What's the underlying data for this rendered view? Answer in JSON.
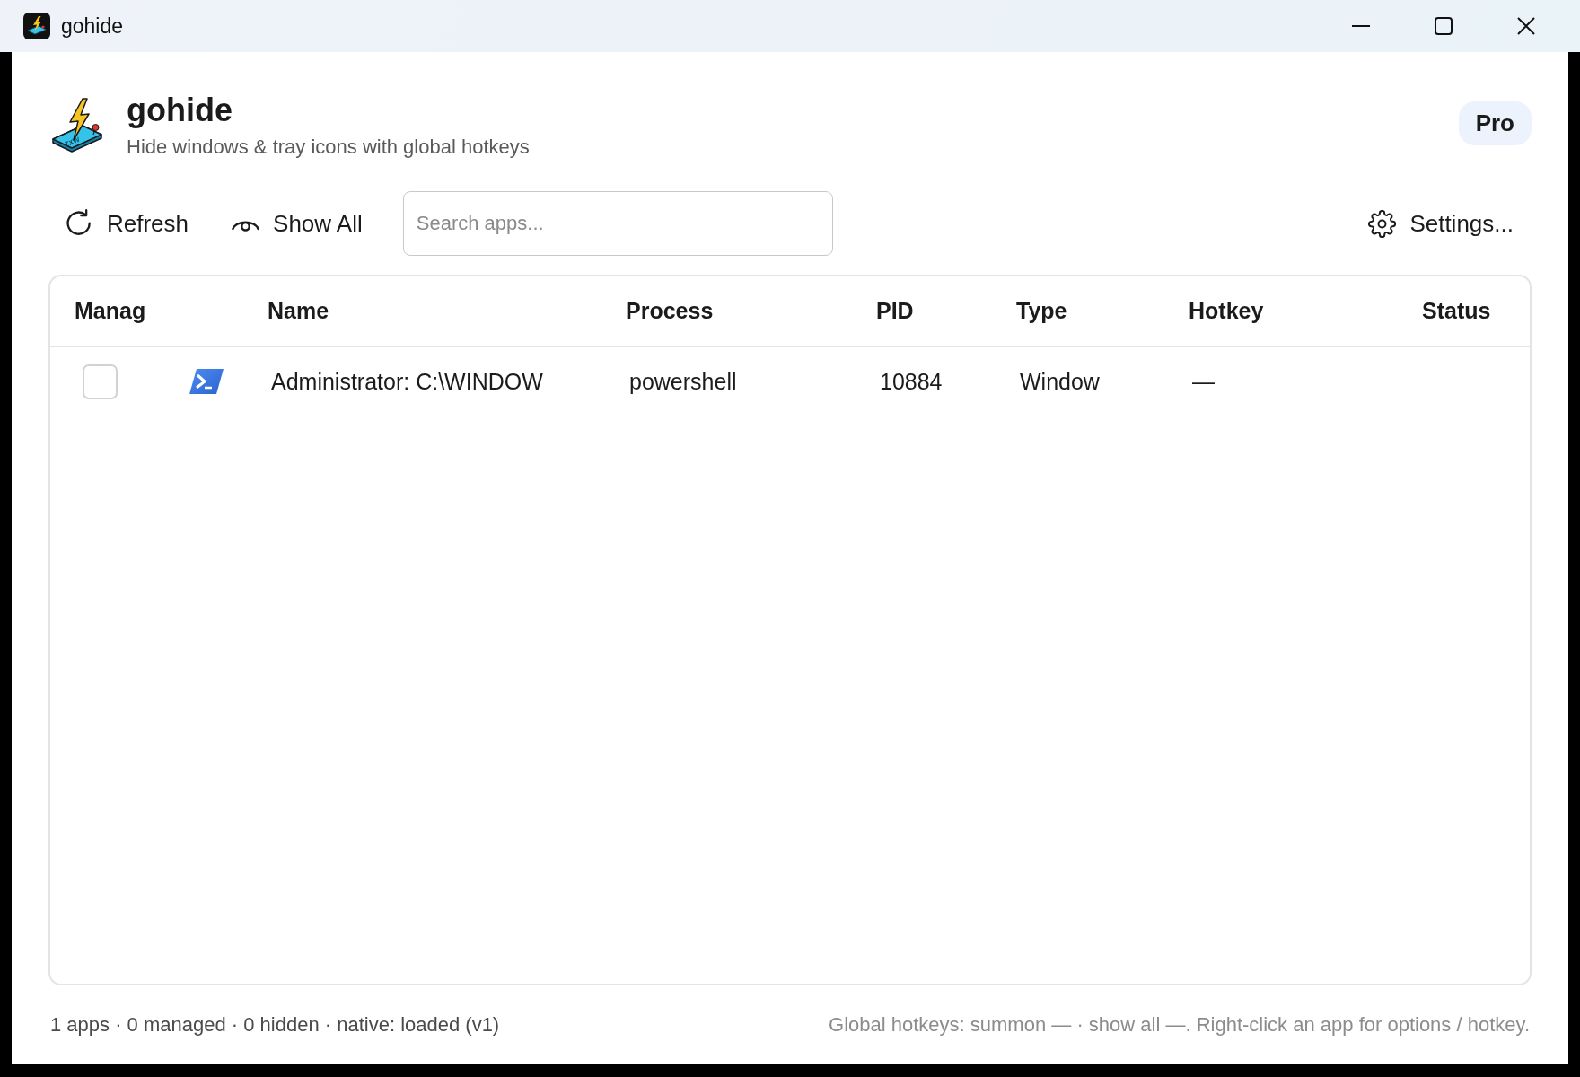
{
  "window": {
    "title": "gohide"
  },
  "header": {
    "title": "gohide",
    "subtitle": "Hide windows & tray icons with global hotkeys",
    "logo_text": "zxw",
    "badge": "Pro"
  },
  "toolbar": {
    "buttons": [
      {
        "kind": "refresh",
        "label": "Refresh"
      },
      {
        "kind": "show_all",
        "label": "Show All"
      }
    ],
    "search": {
      "placeholder": "Search apps..."
    },
    "settings": {
      "label": "Settings..."
    }
  },
  "table": {
    "columns": [
      "Manag",
      "Name",
      "Process",
      "PID",
      "Type",
      "Hotkey",
      "Status"
    ],
    "rows": [
      {
        "checked": false,
        "name": "Administrator: C:\\WINDOW",
        "process": "powershell",
        "pid": "10884",
        "type": "Window",
        "hotkey": "—"
      }
    ]
  },
  "footer": {
    "summary": "1 apps · 0 managed · 0 hidden · native: loaded (v1)",
    "hint": "Global hotkeys: summon — · show all —. Right-click an app for options / hotkey."
  }
}
